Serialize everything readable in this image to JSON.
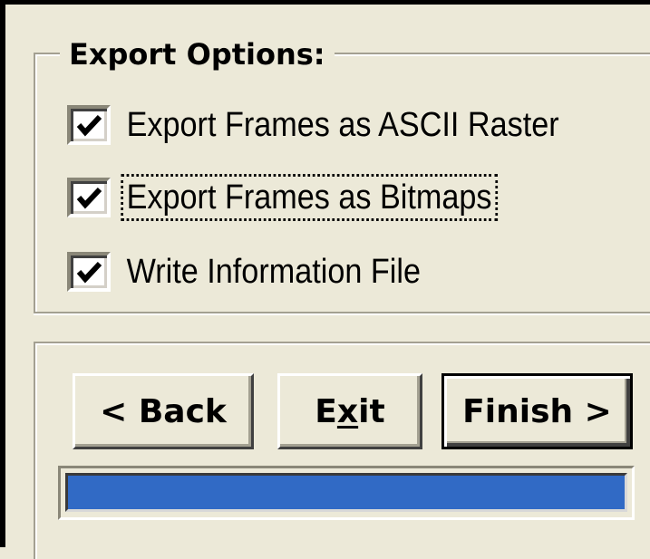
{
  "export_options": {
    "title": "Export Options:",
    "options": [
      {
        "label": "Export Frames as ASCII Raster",
        "checked": true,
        "focused": false
      },
      {
        "label": "Export Frames as Bitmaps",
        "checked": true,
        "focused": true
      },
      {
        "label": "Write Information File",
        "checked": true,
        "focused": false
      }
    ]
  },
  "buttons": {
    "back_label": "< Back",
    "exit_label_pre": "E",
    "exit_label_mnemonic": "x",
    "exit_label_post": "it",
    "finish_label": "Finish >"
  },
  "progress": {
    "value_percent": 100
  },
  "colors": {
    "window_bg": "#ECE9D8",
    "progress_fill": "#316AC5",
    "checkmark": "#000000"
  }
}
